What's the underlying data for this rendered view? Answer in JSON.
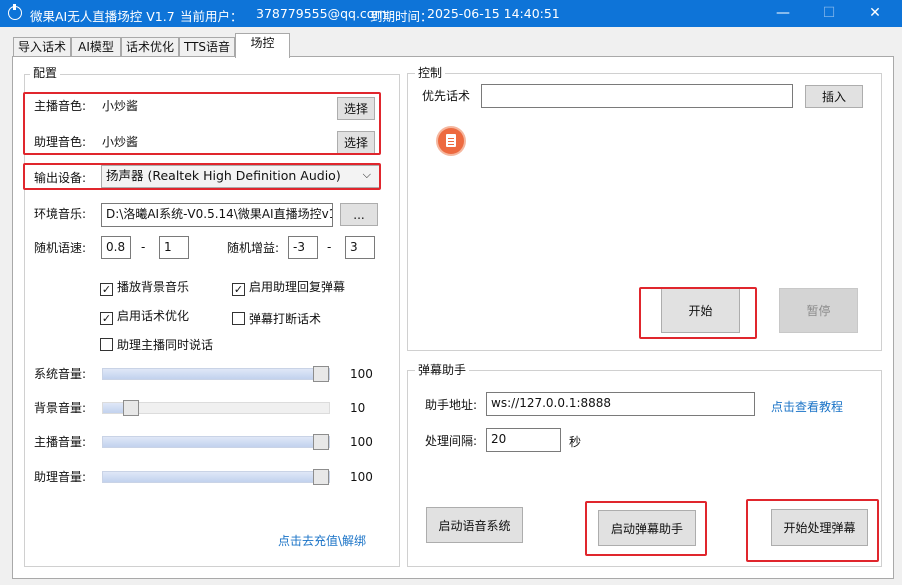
{
  "window": {
    "title": "微果AI无人直播场控 V1.7",
    "user_label": "当前用户：",
    "user": "378779555@qq.com",
    "expiry_label": "到期时间：",
    "expiry": "2025-06-15 14:40:51",
    "minimize": "—",
    "maximize": "☐",
    "close": "✕"
  },
  "tabs": [
    "导入话术",
    "AI模型",
    "话术优化",
    "TTS语音",
    "场控"
  ],
  "active_tab": "场控",
  "config": {
    "group_label": "配置",
    "host_voice_label": "主播音色:",
    "host_voice_value": "小炒酱",
    "assist_voice_label": "助理音色:",
    "assist_voice_value": "小炒酱",
    "select_button": "选择",
    "output_device_label": "输出设备:",
    "output_device_value": "扬声器 (Realtek High Definition Audio)",
    "ambient_label": "环境音乐:",
    "ambient_path": "D:\\洛曦AI系统-V0.5.14\\微果AI直播场控v1",
    "browse_button": "...",
    "rand_speed_label": "随机语速:",
    "rand_speed_min": "0.8",
    "rand_speed_max": "1",
    "rand_gain_label": "随机增益:",
    "rand_gain_min": "-3",
    "rand_gain_max": "3",
    "dash": "-",
    "checkboxes": {
      "play_bg_music": {
        "label": "播放背景音乐",
        "checked": true
      },
      "assist_reply_danmaku": {
        "label": "启用助理回复弹幕",
        "checked": true
      },
      "script_optimize": {
        "label": "启用话术优化",
        "checked": true
      },
      "danmaku_interrupt": {
        "label": "弹幕打断话术",
        "checked": false
      },
      "simul_talk": {
        "label": "助理主播同时说话",
        "checked": false
      }
    },
    "sliders": [
      {
        "label": "系统音量:",
        "value": "100",
        "fraction": 1.0
      },
      {
        "label": "背景音量:",
        "value": "10",
        "fraction": 0.1
      },
      {
        "label": "主播音量:",
        "value": "100",
        "fraction": 1.0
      },
      {
        "label": "助理音量:",
        "value": "100",
        "fraction": 1.0
      }
    ],
    "recharge_link": "点击去充值\\解绑"
  },
  "control": {
    "group_label": "控制",
    "priority_label": "优先话术",
    "priority_value": "",
    "insert_button": "插入",
    "start_button": "开始",
    "pause_button": "暂停"
  },
  "danmaku": {
    "group_label": "弹幕助手",
    "address_label": "助手地址:",
    "address_value": "ws://127.0.0.1:8888",
    "tutorial_link": "点击查看教程",
    "interval_label": "处理间隔:",
    "interval_value": "20",
    "interval_unit": "秒",
    "start_voice_button": "启动语音系统",
    "start_danmaku_button": "启动弹幕助手",
    "process_danmaku_button": "开始处理弹幕"
  },
  "colors": {
    "titlebar": "#0e74d8",
    "highlight": "#e0262d",
    "link": "#1a73c7"
  }
}
